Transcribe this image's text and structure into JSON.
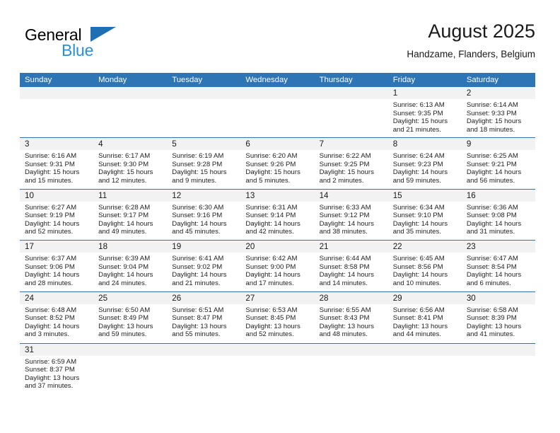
{
  "brand": {
    "line1": "General",
    "line2": "Blue",
    "triangle_color": "#1f6fb4",
    "blue_text_color": "#2a8fd6"
  },
  "header": {
    "title": "August 2025",
    "subtitle": "Handzame, Flanders, Belgium"
  },
  "theme": {
    "header_blue": "#2e75b6",
    "daynum_band": "#f2f2f2",
    "text": "#222222"
  },
  "calendar": {
    "weekday_headers": [
      "Sunday",
      "Monday",
      "Tuesday",
      "Wednesday",
      "Thursday",
      "Friday",
      "Saturday"
    ],
    "weeks": [
      [
        {
          "day": "",
          "empty": true
        },
        {
          "day": "",
          "empty": true
        },
        {
          "day": "",
          "empty": true
        },
        {
          "day": "",
          "empty": true
        },
        {
          "day": "",
          "empty": true
        },
        {
          "day": "1",
          "sunrise": "Sunrise: 6:13 AM",
          "sunset": "Sunset: 9:35 PM",
          "daylight": "Daylight: 15 hours and 21 minutes."
        },
        {
          "day": "2",
          "sunrise": "Sunrise: 6:14 AM",
          "sunset": "Sunset: 9:33 PM",
          "daylight": "Daylight: 15 hours and 18 minutes."
        }
      ],
      [
        {
          "day": "3",
          "sunrise": "Sunrise: 6:16 AM",
          "sunset": "Sunset: 9:31 PM",
          "daylight": "Daylight: 15 hours and 15 minutes."
        },
        {
          "day": "4",
          "sunrise": "Sunrise: 6:17 AM",
          "sunset": "Sunset: 9:30 PM",
          "daylight": "Daylight: 15 hours and 12 minutes."
        },
        {
          "day": "5",
          "sunrise": "Sunrise: 6:19 AM",
          "sunset": "Sunset: 9:28 PM",
          "daylight": "Daylight: 15 hours and 9 minutes."
        },
        {
          "day": "6",
          "sunrise": "Sunrise: 6:20 AM",
          "sunset": "Sunset: 9:26 PM",
          "daylight": "Daylight: 15 hours and 5 minutes."
        },
        {
          "day": "7",
          "sunrise": "Sunrise: 6:22 AM",
          "sunset": "Sunset: 9:25 PM",
          "daylight": "Daylight: 15 hours and 2 minutes."
        },
        {
          "day": "8",
          "sunrise": "Sunrise: 6:24 AM",
          "sunset": "Sunset: 9:23 PM",
          "daylight": "Daylight: 14 hours and 59 minutes."
        },
        {
          "day": "9",
          "sunrise": "Sunrise: 6:25 AM",
          "sunset": "Sunset: 9:21 PM",
          "daylight": "Daylight: 14 hours and 56 minutes."
        }
      ],
      [
        {
          "day": "10",
          "sunrise": "Sunrise: 6:27 AM",
          "sunset": "Sunset: 9:19 PM",
          "daylight": "Daylight: 14 hours and 52 minutes."
        },
        {
          "day": "11",
          "sunrise": "Sunrise: 6:28 AM",
          "sunset": "Sunset: 9:17 PM",
          "daylight": "Daylight: 14 hours and 49 minutes."
        },
        {
          "day": "12",
          "sunrise": "Sunrise: 6:30 AM",
          "sunset": "Sunset: 9:16 PM",
          "daylight": "Daylight: 14 hours and 45 minutes."
        },
        {
          "day": "13",
          "sunrise": "Sunrise: 6:31 AM",
          "sunset": "Sunset: 9:14 PM",
          "daylight": "Daylight: 14 hours and 42 minutes."
        },
        {
          "day": "14",
          "sunrise": "Sunrise: 6:33 AM",
          "sunset": "Sunset: 9:12 PM",
          "daylight": "Daylight: 14 hours and 38 minutes."
        },
        {
          "day": "15",
          "sunrise": "Sunrise: 6:34 AM",
          "sunset": "Sunset: 9:10 PM",
          "daylight": "Daylight: 14 hours and 35 minutes."
        },
        {
          "day": "16",
          "sunrise": "Sunrise: 6:36 AM",
          "sunset": "Sunset: 9:08 PM",
          "daylight": "Daylight: 14 hours and 31 minutes."
        }
      ],
      [
        {
          "day": "17",
          "sunrise": "Sunrise: 6:37 AM",
          "sunset": "Sunset: 9:06 PM",
          "daylight": "Daylight: 14 hours and 28 minutes."
        },
        {
          "day": "18",
          "sunrise": "Sunrise: 6:39 AM",
          "sunset": "Sunset: 9:04 PM",
          "daylight": "Daylight: 14 hours and 24 minutes."
        },
        {
          "day": "19",
          "sunrise": "Sunrise: 6:41 AM",
          "sunset": "Sunset: 9:02 PM",
          "daylight": "Daylight: 14 hours and 21 minutes."
        },
        {
          "day": "20",
          "sunrise": "Sunrise: 6:42 AM",
          "sunset": "Sunset: 9:00 PM",
          "daylight": "Daylight: 14 hours and 17 minutes."
        },
        {
          "day": "21",
          "sunrise": "Sunrise: 6:44 AM",
          "sunset": "Sunset: 8:58 PM",
          "daylight": "Daylight: 14 hours and 14 minutes."
        },
        {
          "day": "22",
          "sunrise": "Sunrise: 6:45 AM",
          "sunset": "Sunset: 8:56 PM",
          "daylight": "Daylight: 14 hours and 10 minutes."
        },
        {
          "day": "23",
          "sunrise": "Sunrise: 6:47 AM",
          "sunset": "Sunset: 8:54 PM",
          "daylight": "Daylight: 14 hours and 6 minutes."
        }
      ],
      [
        {
          "day": "24",
          "sunrise": "Sunrise: 6:48 AM",
          "sunset": "Sunset: 8:52 PM",
          "daylight": "Daylight: 14 hours and 3 minutes."
        },
        {
          "day": "25",
          "sunrise": "Sunrise: 6:50 AM",
          "sunset": "Sunset: 8:49 PM",
          "daylight": "Daylight: 13 hours and 59 minutes."
        },
        {
          "day": "26",
          "sunrise": "Sunrise: 6:51 AM",
          "sunset": "Sunset: 8:47 PM",
          "daylight": "Daylight: 13 hours and 55 minutes."
        },
        {
          "day": "27",
          "sunrise": "Sunrise: 6:53 AM",
          "sunset": "Sunset: 8:45 PM",
          "daylight": "Daylight: 13 hours and 52 minutes."
        },
        {
          "day": "28",
          "sunrise": "Sunrise: 6:55 AM",
          "sunset": "Sunset: 8:43 PM",
          "daylight": "Daylight: 13 hours and 48 minutes."
        },
        {
          "day": "29",
          "sunrise": "Sunrise: 6:56 AM",
          "sunset": "Sunset: 8:41 PM",
          "daylight": "Daylight: 13 hours and 44 minutes."
        },
        {
          "day": "30",
          "sunrise": "Sunrise: 6:58 AM",
          "sunset": "Sunset: 8:39 PM",
          "daylight": "Daylight: 13 hours and 41 minutes."
        }
      ],
      [
        {
          "day": "31",
          "sunrise": "Sunrise: 6:59 AM",
          "sunset": "Sunset: 8:37 PM",
          "daylight": "Daylight: 13 hours and 37 minutes."
        },
        {
          "day": "",
          "empty": true
        },
        {
          "day": "",
          "empty": true
        },
        {
          "day": "",
          "empty": true
        },
        {
          "day": "",
          "empty": true
        },
        {
          "day": "",
          "empty": true
        },
        {
          "day": "",
          "empty": true
        }
      ]
    ]
  }
}
